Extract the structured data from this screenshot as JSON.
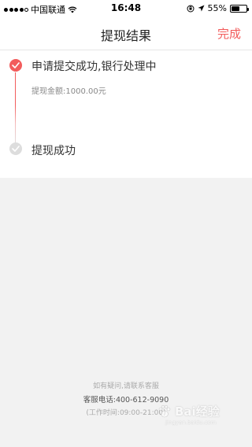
{
  "status_bar": {
    "carrier": "中国联通",
    "time": "16:48",
    "battery": "55%",
    "battery_level": 0.55,
    "signal_bars_filled": 4
  },
  "nav": {
    "title": "提现结果",
    "done_label": "完成"
  },
  "steps": [
    {
      "title": "申请提交成功,银行处理中",
      "detail": "提现金额:1000.00元",
      "state": "done",
      "icon": "check-icon"
    },
    {
      "title": "提现成功",
      "state": "pending",
      "icon": "check-icon"
    }
  ],
  "colors": {
    "accent": "#f25c5c",
    "inactive": "#dddddd"
  },
  "footer": {
    "hint": "如有疑问,请联系客服",
    "phone": "客服电话:400-612-9090",
    "hours": "(工作时间:09:00-21:00)"
  },
  "watermark": {
    "text": "Bai经验",
    "url": "jingyan.baidu.com"
  }
}
